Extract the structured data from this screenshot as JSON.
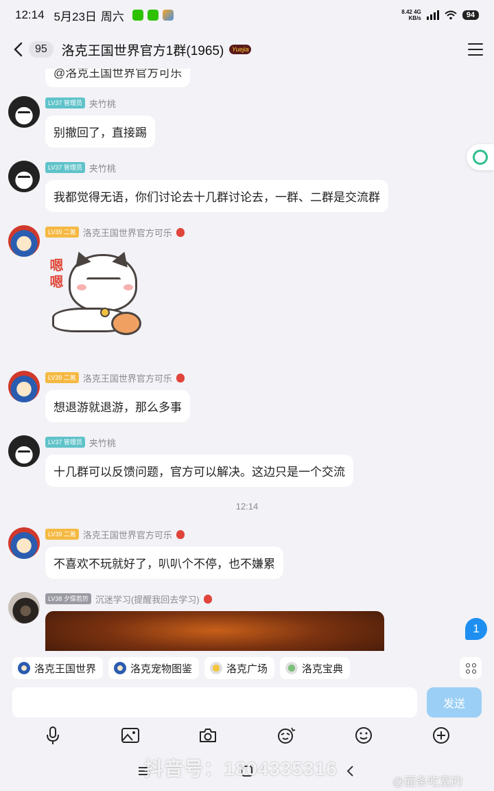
{
  "status_bar": {
    "time": "12:14",
    "date": "5月23日",
    "weekday": "周六",
    "net_speed_value": "8.42",
    "net_speed_unit": "KB/s",
    "network": "4G",
    "battery": "94"
  },
  "header": {
    "unread_count": "95",
    "title": "洛克王国世界官方1群(1965)",
    "badge_text": "Yuejia"
  },
  "chat": {
    "partial_text": "@洛克王国世界官方可乐",
    "time_divider": "12:14",
    "unread_badge": "1",
    "messages": [
      {
        "level": "LV37",
        "title": "管理员",
        "nick": "夹竹桃",
        "text": "别撤回了，直接踢"
      },
      {
        "level": "LV37",
        "title": "管理员",
        "nick": "夹竹桃",
        "text": "我都觉得无语，你们讨论去十几群讨论去，一群、二群是交流群"
      },
      {
        "level": "LV39",
        "title": "二氪",
        "nick": "洛克王国世界官方可乐",
        "sticker_text": "嗯嗯"
      },
      {
        "level": "LV39",
        "title": "二氪",
        "nick": "洛克王国世界官方可乐",
        "text": "想退游就退游，那么多事"
      },
      {
        "level": "LV37",
        "title": "管理员",
        "nick": "夹竹桃",
        "text": "十几群可以反馈问题，官方可以解决。这边只是一个交流"
      },
      {
        "level": "LV39",
        "title": "二氪",
        "nick": "洛克王国世界官方可乐",
        "text": "不喜欢不玩就好了，叭叭个不停，也不嫌累"
      },
      {
        "level": "LV38",
        "title": "夕憬若厉",
        "nick": "沉迷学习(提醒我回去学习)"
      }
    ]
  },
  "shortcuts": [
    "洛克王国世界",
    "洛克宠物图鉴",
    "洛克广场",
    "洛克宝典"
  ],
  "input": {
    "placeholder": "",
    "send_label": "发送"
  },
  "watermark": {
    "text": "抖音号：1804335316",
    "author": "@面条吃宽的"
  },
  "colors": {
    "accent": "#1e8ff0",
    "send_disabled": "#9ccff5",
    "admin_tag": "#5fc3c9",
    "level_tag": "#f5b942"
  }
}
